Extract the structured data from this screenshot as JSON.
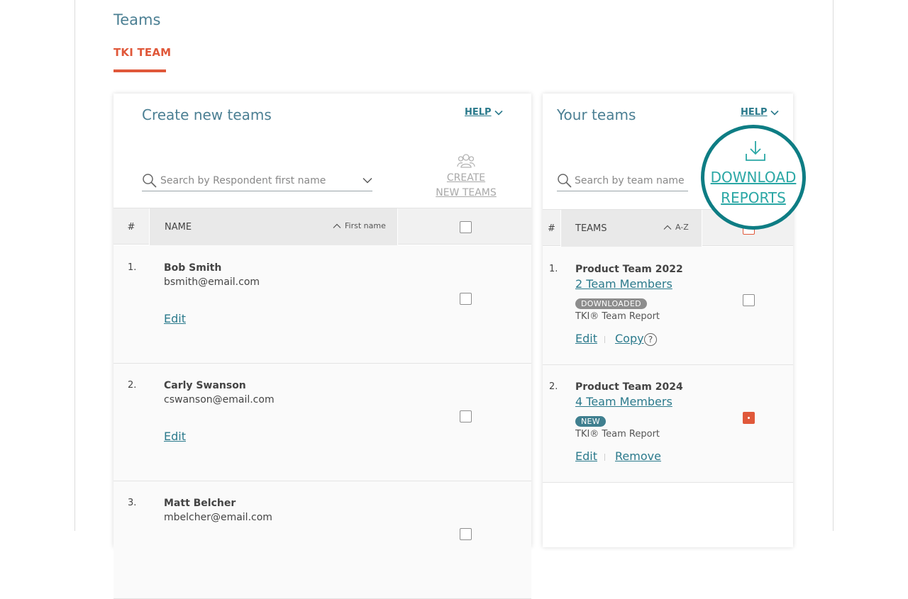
{
  "page": {
    "title": "Teams",
    "tab": "TKI TEAM"
  },
  "left_panel": {
    "title": "Create new teams",
    "help": "HELP",
    "search_placeholder": "Search by Respondent first name",
    "create_button": {
      "line1": "CREATE",
      "line2": "NEW TEAMS"
    },
    "columns": {
      "num": "#",
      "name": "NAME",
      "sort": "First name"
    },
    "rows": [
      {
        "num": "1.",
        "name": "Bob Smith",
        "email": "bsmith@email.com",
        "edit": "Edit"
      },
      {
        "num": "2.",
        "name": "Carly Swanson",
        "email": "cswanson@email.com",
        "edit": "Edit"
      },
      {
        "num": "3.",
        "name": "Matt Belcher",
        "email": "mbelcher@email.com"
      }
    ]
  },
  "right_panel": {
    "title": "Your teams",
    "help": "HELP",
    "search_placeholder": "Search by team name",
    "download": {
      "line1": "DOWNLOAD",
      "line2": "REPORTS"
    },
    "columns": {
      "num": "#",
      "teams": "TEAMS",
      "sort": "A-Z"
    },
    "rows": [
      {
        "num": "1.",
        "name": "Product Team 2022",
        "members": "2 Team Members",
        "badge": "DOWNLOADED",
        "report": "TKI® Team Report",
        "action1": "Edit",
        "action2": "Copy",
        "help_glyph": "?"
      },
      {
        "num": "2.",
        "name": "Product Team 2024",
        "members": "4 Team Members",
        "badge": "NEW",
        "report": "TKI® Team Report",
        "action1": "Edit",
        "action2": "Remove"
      }
    ]
  },
  "colors": {
    "accent": "#e0583a",
    "teal": "#2b7a8c",
    "title": "#4b7f93",
    "highlight_ring": "#0e7d84"
  }
}
